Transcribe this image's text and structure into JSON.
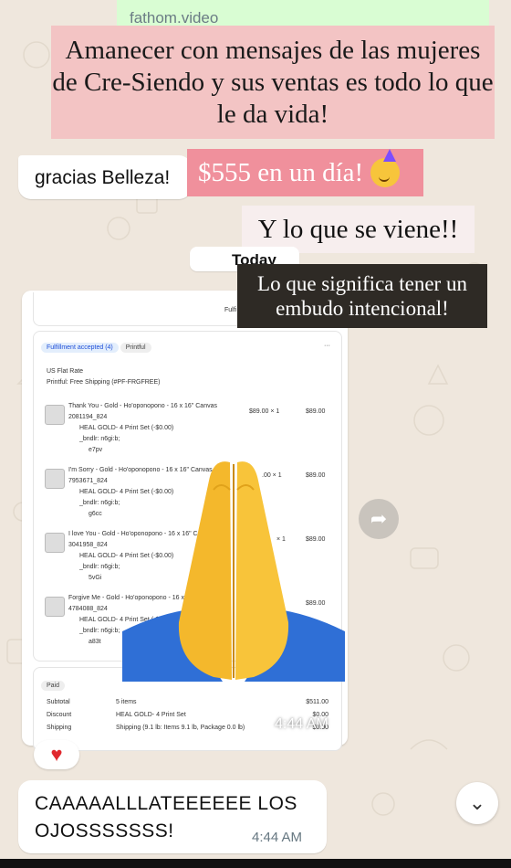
{
  "link_preview": {
    "text": "fathom.video"
  },
  "overlay_title": {
    "text": "Amanecer con mensajes de las mujeres de Cre-Siendo y sus ventas es todo lo que le da vida!"
  },
  "messages": {
    "gracias": "gracias Belleza!",
    "money": "$555 en un día!",
    "viene": "Y lo que se viene!!",
    "today": "Today",
    "funnel": "Lo que significa tener un embudo intencional!",
    "screenshot_time": "4:44 AM",
    "call_text": "CAAAAALLLATEEEEEE LOS OJOSSSSSSS!",
    "call_time": "4:44 AM"
  },
  "order": {
    "fulfill_button": "Fulfi",
    "badge_fulfilled": "Fulfillment accepted (4)",
    "badge_printful": "Printful",
    "shipping_method": "US Flat Rate",
    "shipping_sub": "Printful: Free Shipping (#PF-FRGFREE)",
    "items": [
      {
        "title": "Thank You - Gold - Ho'oponopono - 16 x 16\" Canvas",
        "variant": "Gold",
        "sku": "2081194_824",
        "addon": "HEAL GOLD- 4 Print Set (-$0.00)",
        "bndlr": "_bndlr: n6gi:b;",
        "code": "e7pv",
        "price": "$89.00 × 1",
        "total": "$89.00"
      },
      {
        "title": "I'm Sorry - Gold - Ho'oponopono - 16 x 16\" Canvas",
        "variant": "Gold",
        "sku": "7953671_824",
        "addon": "HEAL GOLD- 4 Print Set (-$0.00)",
        "bndlr": "_bndlr: n6gi:b;",
        "code": "g6cc",
        "price": ".00 × 1",
        "total": "$89.00"
      },
      {
        "title": "I love You - Gold - Ho'oponopono - 16 x 16\" Canv",
        "variant": "Gold",
        "sku": "3041958_824",
        "addon": "HEAL GOLD- 4 Print Set (-$0.00)",
        "bndlr": "_bndlr: n6gi:b;",
        "code": "5vGi",
        "price": "× 1",
        "total": "$89.00"
      },
      {
        "title": "Forgive Me - Gold - Ho'oponopono - 16 x 1",
        "variant": "Gold",
        "sku": "4784088_824",
        "addon": "HEAL GOLD- 4 Print Set (-$0.0",
        "bndlr": "_bndlr: n6gi:b;",
        "code": "a83t",
        "price": "",
        "total": "$89.00"
      }
    ],
    "paid_badge": "Paid",
    "summary": [
      {
        "label": "Subtotal",
        "desc": "5 items",
        "value": "$511.00"
      },
      {
        "label": "Discount",
        "desc": "HEAL GOLD- 4 Print Set",
        "value": "$0.00"
      },
      {
        "label": "Shipping",
        "desc": "Shipping (9.1 lb: Items 9.1 lb, Package 0.0 lb)",
        "value": "$0.00"
      }
    ]
  },
  "colors": {
    "bubble_green": "#d9fdd3",
    "pink_overlay": "#f3c4c4",
    "money_pink": "#f0909c",
    "dark_overlay": "#2e2a25",
    "heart_red": "#e0282e"
  }
}
